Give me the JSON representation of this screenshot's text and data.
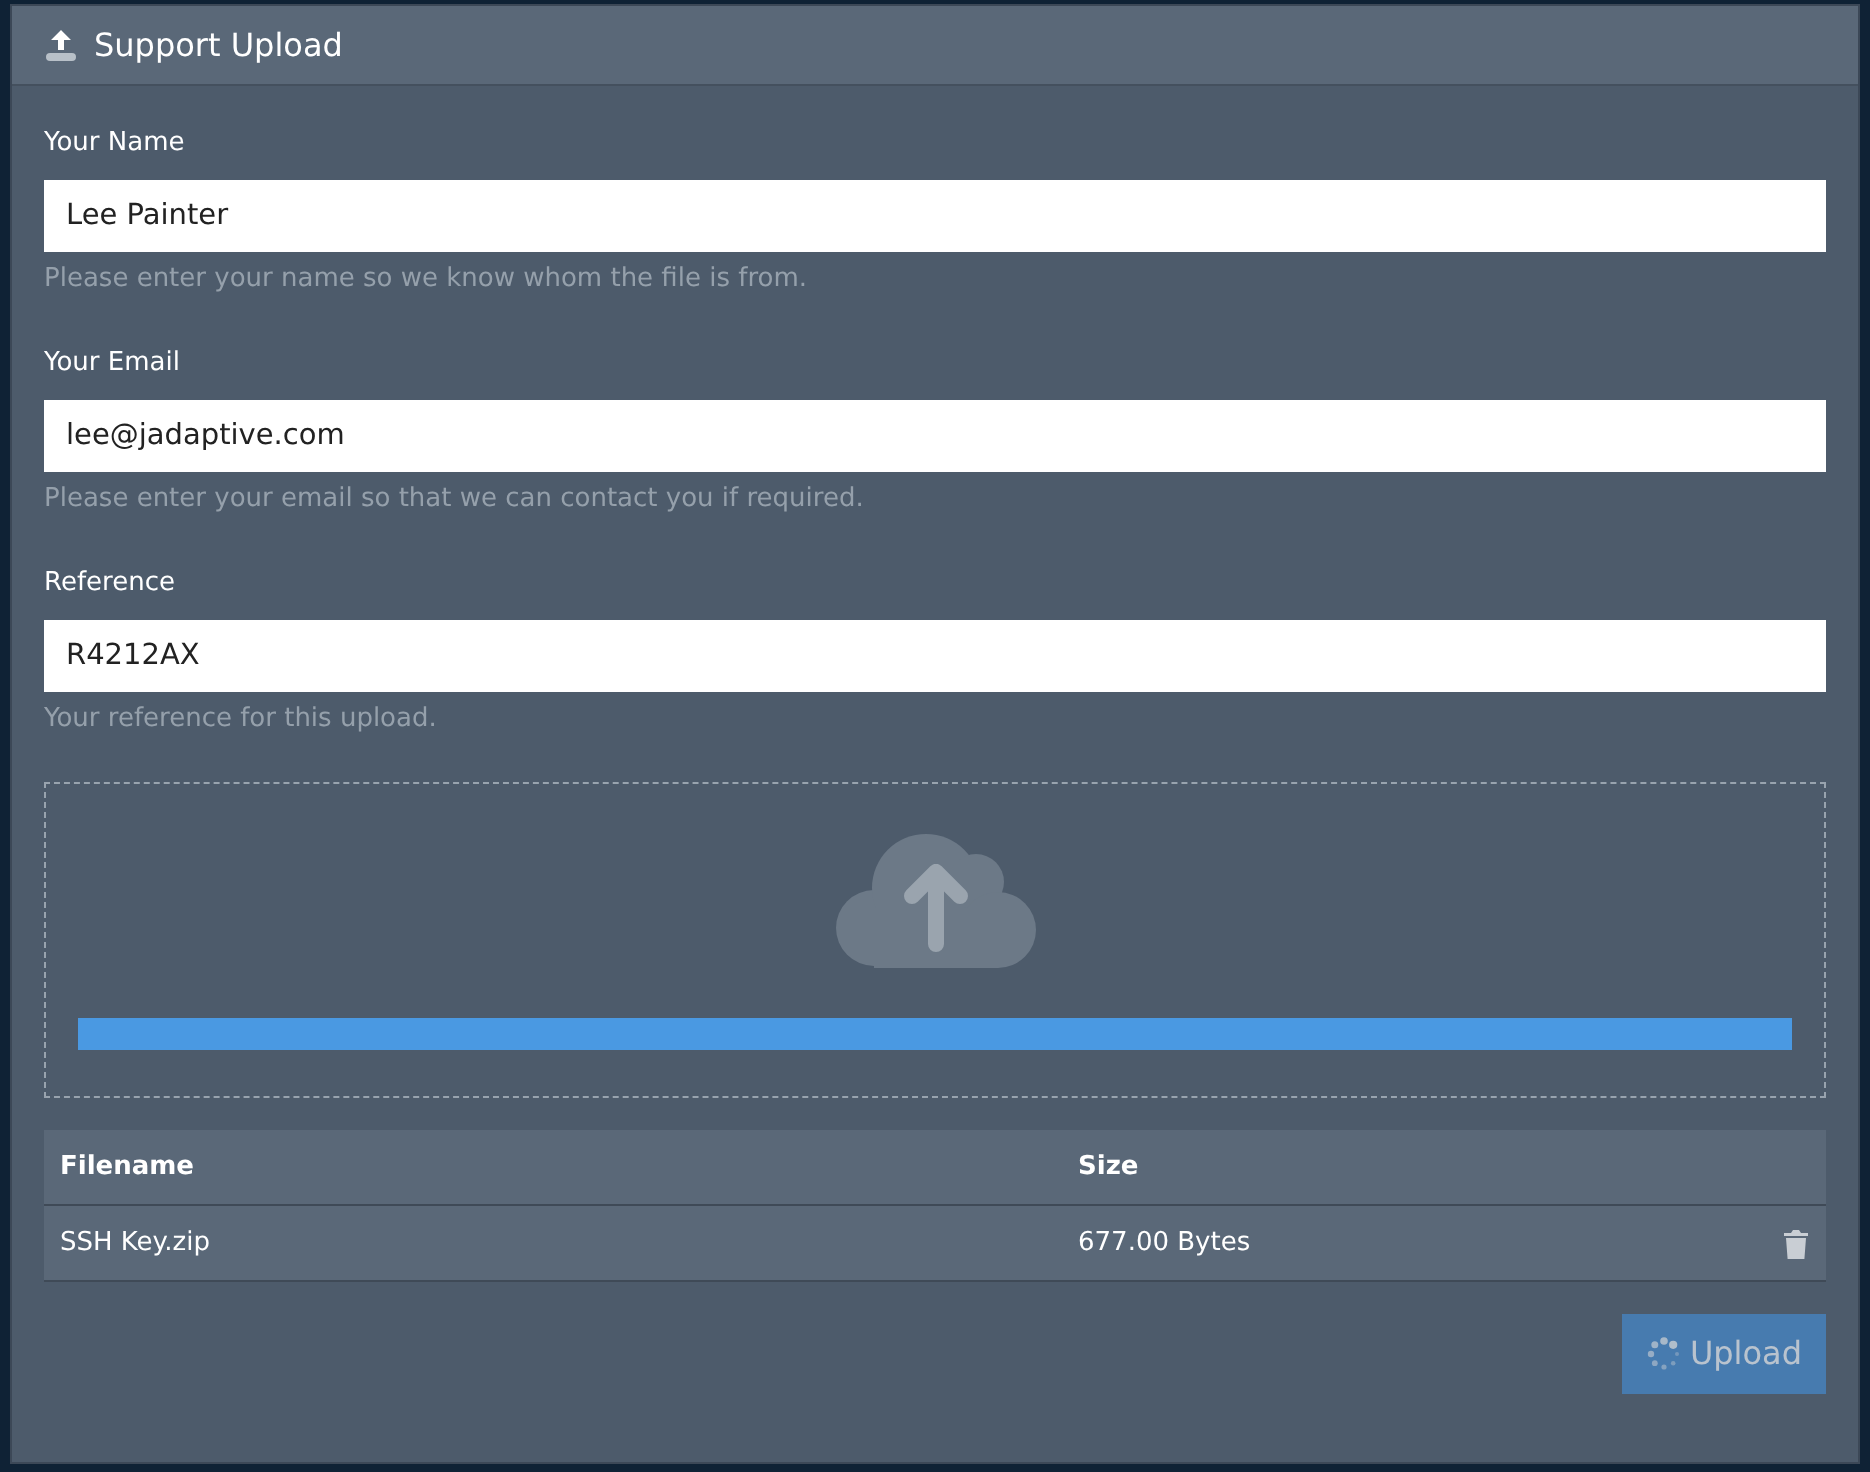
{
  "panel": {
    "title": "Support Upload"
  },
  "fields": [
    {
      "label": "Your Name",
      "value": "Lee Painter",
      "help": "Please enter your name so we know whom the file is from."
    },
    {
      "label": "Your Email",
      "value": "lee@jadaptive.com",
      "help": "Please enter your email so that we can contact you if required."
    },
    {
      "label": "Reference",
      "value": "R4212AX",
      "help": "Your reference for this upload."
    }
  ],
  "dropzone": {
    "level": 1
  },
  "table": {
    "columns": [
      "Filename",
      "Size"
    ],
    "rows": [
      {
        "filename": "SSH Key.zip",
        "size": "677.00 Bytes"
      }
    ]
  },
  "upload_button": {
    "label": "Upload",
    "disabled": true,
    "busy": true
  }
}
